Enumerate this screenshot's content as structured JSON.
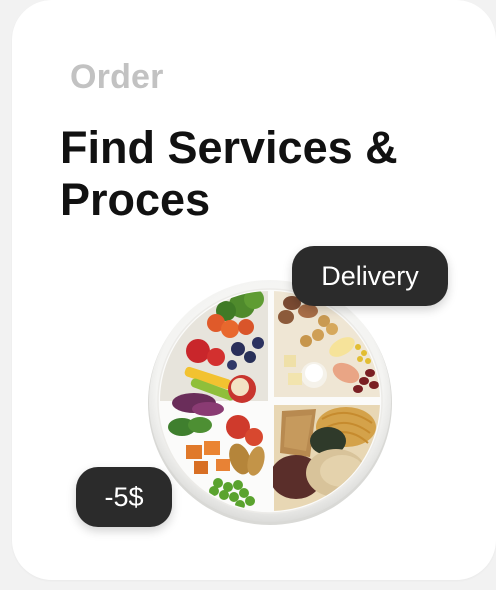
{
  "card": {
    "eyebrow": "Order",
    "title": "Find Services & Proces"
  },
  "badges": {
    "delivery": "Delivery",
    "discount": "-5$"
  },
  "colors": {
    "badge_bg": "#2b2b2b",
    "eyebrow": "#c2c2c2",
    "title": "#111111"
  }
}
